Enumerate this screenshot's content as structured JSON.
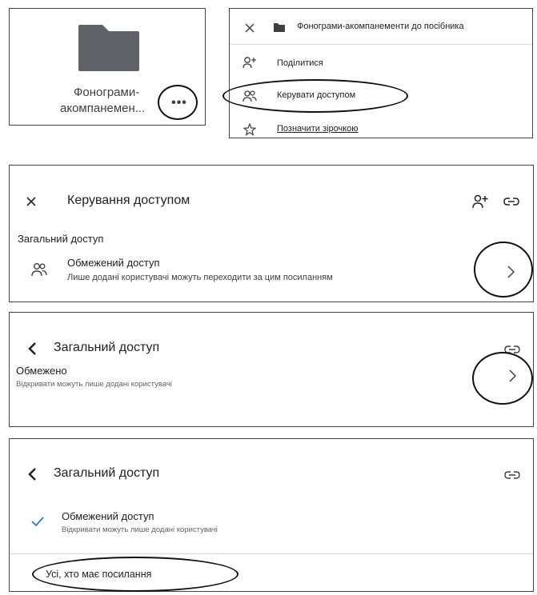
{
  "folder_card": {
    "name_line1": "Фонограми-",
    "name_line2": "акомпанемен...",
    "more_icon": "more-horizontal-icon"
  },
  "context_menu": {
    "header": "Фонограми-акомпанементи до посібника",
    "items": [
      {
        "label": "Поділитися",
        "icon": "person-add-icon"
      },
      {
        "label": "Керувати доступом",
        "icon": "manage-access-icon"
      },
      {
        "label": "Позначити зірочкою",
        "icon": "star-icon"
      }
    ]
  },
  "manage_access": {
    "title": "Керування доступом",
    "section_title": "Загальний доступ",
    "access_title": "Обмежений доступ",
    "access_desc": "Лише додані користувачі можуть переходити за цим посиланням"
  },
  "general_access": {
    "title": "Загальний доступ",
    "option_title": "Обмежено",
    "option_desc": "Відкривати можуть лише додані користувачі"
  },
  "general_access_options": {
    "title": "Загальний доступ",
    "selected_title": "Обмежений доступ",
    "selected_desc": "Відкривати можуть лише додані користувачі",
    "other_option": "Усі, хто має посилання"
  },
  "colors": {
    "check": "#1a73e8",
    "folder": "#5f6368",
    "annotation": "#111111"
  }
}
